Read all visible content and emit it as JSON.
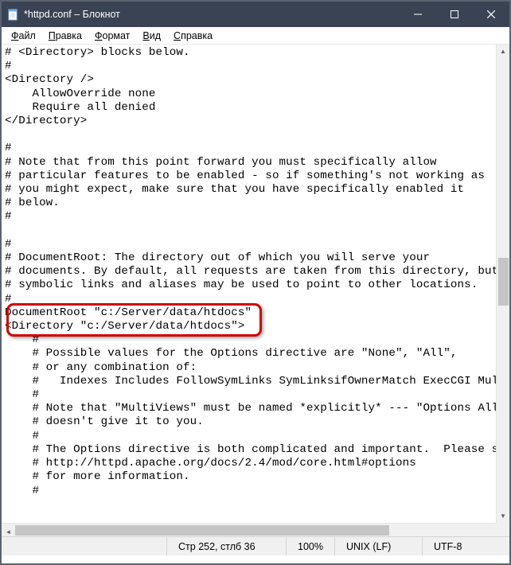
{
  "titlebar": {
    "title": "*httpd.conf – Блокнот"
  },
  "menubar": {
    "file": "Файл",
    "edit": "Правка",
    "format": "Формат",
    "view": "Вид",
    "help": "Справка"
  },
  "editor": {
    "content": "# <Directory> blocks below.\n#\n<Directory />\n    AllowOverride none\n    Require all denied\n</Directory>\n\n#\n# Note that from this point forward you must specifically allow\n# particular features to be enabled - so if something's not working as\n# you might expect, make sure that you have specifically enabled it\n# below.\n#\n\n#\n# DocumentRoot: The directory out of which you will serve your\n# documents. By default, all requests are taken from this directory, but\n# symbolic links and aliases may be used to point to other locations.\n#\nDocumentRoot \"c:/Server/data/htdocs\"\n<Directory \"c:/Server/data/htdocs\">\n    #\n    # Possible values for the Options directive are \"None\", \"All\",\n    # or any combination of:\n    #   Indexes Includes FollowSymLinks SymLinksifOwnerMatch ExecCGI MultiViews\n    #\n    # Note that \"MultiViews\" must be named *explicitly* --- \"Options All\"\n    # doesn't give it to you.\n    #\n    # The Options directive is both complicated and important.  Please see\n    # http://httpd.apache.org/docs/2.4/mod/core.html#options\n    # for more information.\n    #"
  },
  "statusbar": {
    "position": "Стр 252, стлб 36",
    "zoom": "100%",
    "line_ending": "UNIX (LF)",
    "encoding": "UTF-8"
  }
}
